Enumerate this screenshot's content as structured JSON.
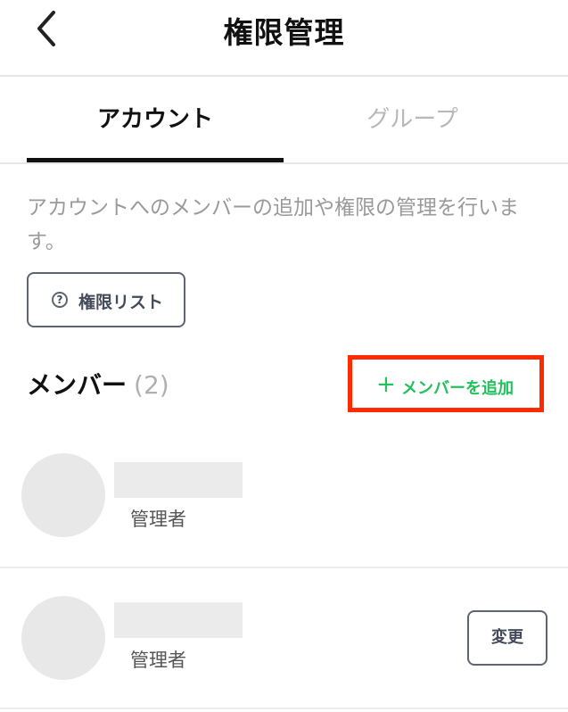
{
  "header": {
    "back_icon": "chevron-left-icon",
    "title": "権限管理"
  },
  "tabs": [
    {
      "label": "アカウント",
      "active": true
    },
    {
      "label": "グループ",
      "active": false
    }
  ],
  "description": "アカウントへのメンバーの追加や権限の管理を行います。",
  "permission_list_button": {
    "icon": "question-circle-icon",
    "label": "権限リスト"
  },
  "members": {
    "title": "メンバー",
    "count": "(2)",
    "add_button": {
      "icon": "plus-icon",
      "label": "メンバーを追加"
    },
    "items": [
      {
        "role": "管理者",
        "action": ""
      },
      {
        "role": "管理者",
        "action": "変更"
      }
    ]
  },
  "colors": {
    "accent_green": "#22c15e",
    "highlight_red": "#ff2a00",
    "muted_text": "#9a9a9a"
  }
}
